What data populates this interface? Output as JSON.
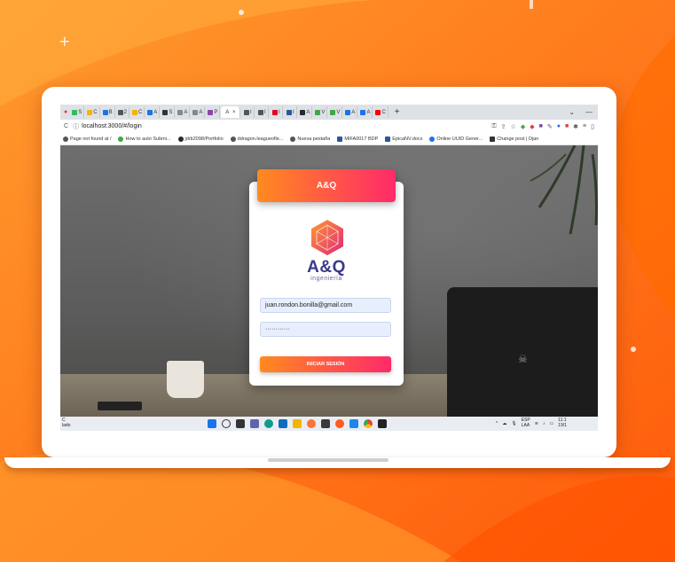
{
  "browser": {
    "url": "localhost:3000/#/login",
    "tabs": [
      {
        "label": "S",
        "color": "#2ebd59"
      },
      {
        "label": "C",
        "color": "#f4b400"
      },
      {
        "label": "B",
        "color": "#1a73e8"
      },
      {
        "label": "2",
        "color": "#555555"
      },
      {
        "label": "C",
        "color": "#f4b400"
      },
      {
        "label": "A",
        "color": "#1a73e8"
      },
      {
        "label": "S",
        "color": "#333333"
      },
      {
        "label": "A",
        "color": "#888888"
      },
      {
        "label": "A",
        "color": "#888888"
      },
      {
        "label": "P",
        "color": "#8e44ad"
      }
    ],
    "active_tab": {
      "label": "A",
      "close": "×"
    },
    "tabs_after": [
      {
        "label": "I",
        "color": "#555555"
      },
      {
        "label": "I",
        "color": "#555555"
      },
      {
        "label": "I",
        "color": "#e60023"
      },
      {
        "label": "I",
        "color": "#2b579a"
      },
      {
        "label": "A",
        "color": "#24292f"
      },
      {
        "label": "V",
        "color": "#3ea844"
      },
      {
        "label": "V",
        "color": "#3ea844"
      },
      {
        "label": "A",
        "color": "#1a73e8"
      },
      {
        "label": "A",
        "color": "#1a73e8"
      },
      {
        "label": "C",
        "color": "#ff0000"
      }
    ],
    "new_tab": "+",
    "window_controls": {
      "dropdown": "⌄",
      "minimize": "—"
    },
    "bookmarks": [
      {
        "label": "Page not found at /",
        "color": "#555555"
      },
      {
        "label": "How to auto Submi...",
        "color": "#3ea844"
      },
      {
        "label": "jdrb2098/Portfolio",
        "color": "#24292f"
      },
      {
        "label": "ddragon.leagueofle...",
        "color": "#555555"
      },
      {
        "label": "Nueva pestaña",
        "color": "#555555"
      },
      {
        "label": "MIFA0017 BDP",
        "color": "#2b579a"
      },
      {
        "label": "EpicaNV.docx",
        "color": "#2b579a"
      },
      {
        "label": "Online UUID Gener...",
        "color": "#1a73e8"
      },
      {
        "label": "Change post | Djan",
        "color": "#333333"
      }
    ]
  },
  "login": {
    "header_title": "A&Q",
    "brand_name": "A&Q",
    "brand_sub": "ingeniería",
    "email_value": "juan.rondon.bonilla@gmail.com",
    "password_value": "············",
    "submit_label": "INICIAR SESIÓN"
  },
  "taskbar": {
    "left_line1": "C",
    "left_line2": "lado",
    "lang": "ESP",
    "lang2": "LAA",
    "time": "11:1",
    "date": "19/1"
  },
  "colors": {
    "accent_start": "#ff8a1f",
    "accent_end": "#ff2a6a",
    "background": "#ff7a1a",
    "brand_text": "#3a3a8a"
  }
}
